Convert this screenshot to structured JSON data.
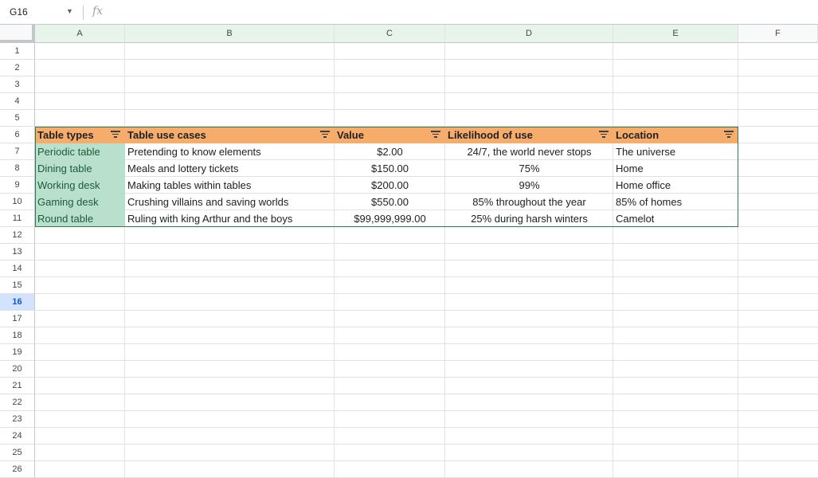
{
  "formula_bar": {
    "name_box": "G16",
    "fx_icon": "fx-icon",
    "formula": ""
  },
  "columns": [
    "A",
    "B",
    "C",
    "D",
    "E",
    "F"
  ],
  "rows": [
    "1",
    "2",
    "3",
    "4",
    "5",
    "6",
    "7",
    "8",
    "9",
    "10",
    "11",
    "12",
    "13",
    "14",
    "15",
    "16",
    "17",
    "18",
    "19",
    "20",
    "21",
    "22",
    "23",
    "24",
    "25",
    "26"
  ],
  "active_row": "16",
  "table": {
    "headers": [
      "Table types",
      "Table use cases",
      "Value",
      "Likelihood of use",
      "Location"
    ],
    "rows": [
      [
        "Periodic table",
        "Pretending to know elements",
        "$2.00",
        "24/7, the world never stops",
        "The universe"
      ],
      [
        "Dining table",
        "Meals and lottery tickets",
        "$150.00",
        "75%",
        "Home"
      ],
      [
        "Working desk",
        "Making tables within tables",
        "$200.00",
        "99%",
        "Home office"
      ],
      [
        "Gaming desk",
        "Crushing villains and saving worlds",
        "$550.00",
        "85% throughout the year",
        "85% of homes"
      ],
      [
        "Round table",
        "Ruling with king Arthur and the boys",
        "$99,999,999.00",
        "25% during harsh winters",
        "Camelot"
      ]
    ]
  },
  "colors": {
    "header_fill": "#f6ad6b",
    "type_column_fill": "#b8e0cc",
    "table_border": "#2e7d4f",
    "active_row_highlight": "#d3e3fd"
  }
}
